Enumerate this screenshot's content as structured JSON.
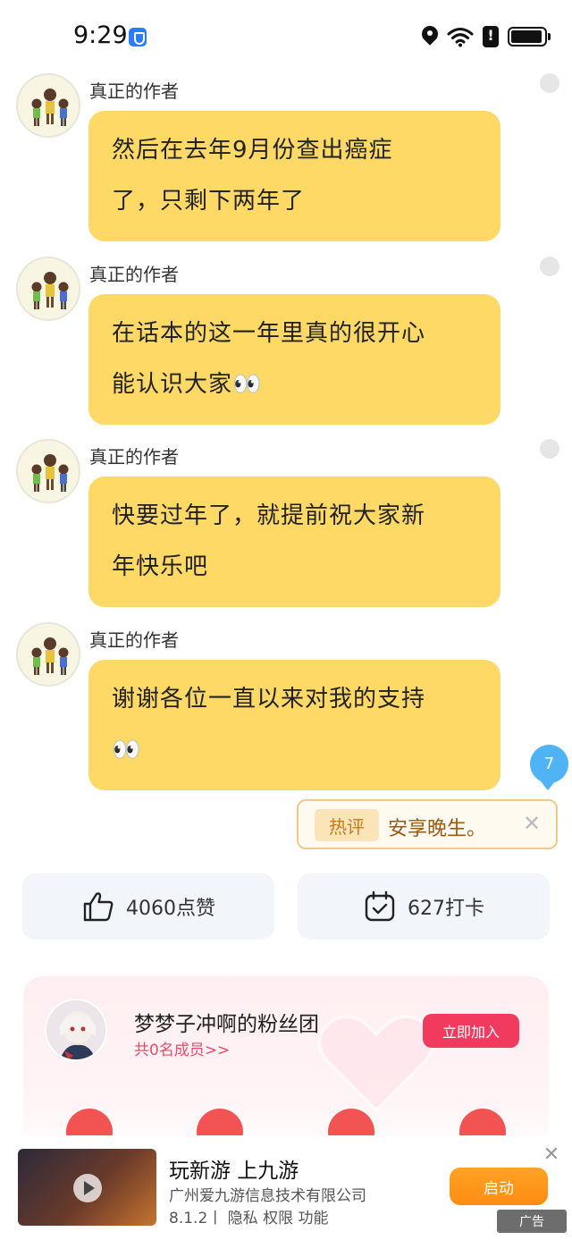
{
  "status_bar": {
    "time": "9:29",
    "battery_fill_fraction": 0.95
  },
  "messages": [
    {
      "author": "真正的作者",
      "text_line1": "然后在去年9月份查出癌症",
      "text_line2": "了，只剩下两年了"
    },
    {
      "author": "真正的作者",
      "text_line1": "在话本的这一年里真的很开心",
      "text_line2": "能认识大家👀"
    },
    {
      "author": "真正的作者",
      "text_line1": "快要过年了，就提前祝大家新",
      "text_line2": "年快乐吧"
    },
    {
      "author": "真正的作者",
      "text_line1": "谢谢各位一直以来对我的支持",
      "text_line2": "👀"
    }
  ],
  "unread_badge": "7",
  "hot_comment": {
    "tag": "热评",
    "text": "安享晚生。",
    "close": "✕"
  },
  "stats": {
    "likes_label": "4060点赞",
    "checkins_label": "627打卡"
  },
  "fan_club": {
    "name": "梦梦子冲啊的粉丝团",
    "members": "共0名成员>>",
    "join_label": "立即加入"
  },
  "ad": {
    "title": "玩新游 上九游",
    "company": "广州爱九游信息技术有限公司",
    "meta": "8.1.2丨 隐私  权限  功能",
    "launch_label": "启动",
    "close": "✕",
    "ad_label": "广告"
  },
  "colors": {
    "bubble": "#ffd966",
    "accent_blue": "#4fb3f5",
    "join_red": "#f23a5e",
    "launch_orange": "#ff8c12"
  }
}
